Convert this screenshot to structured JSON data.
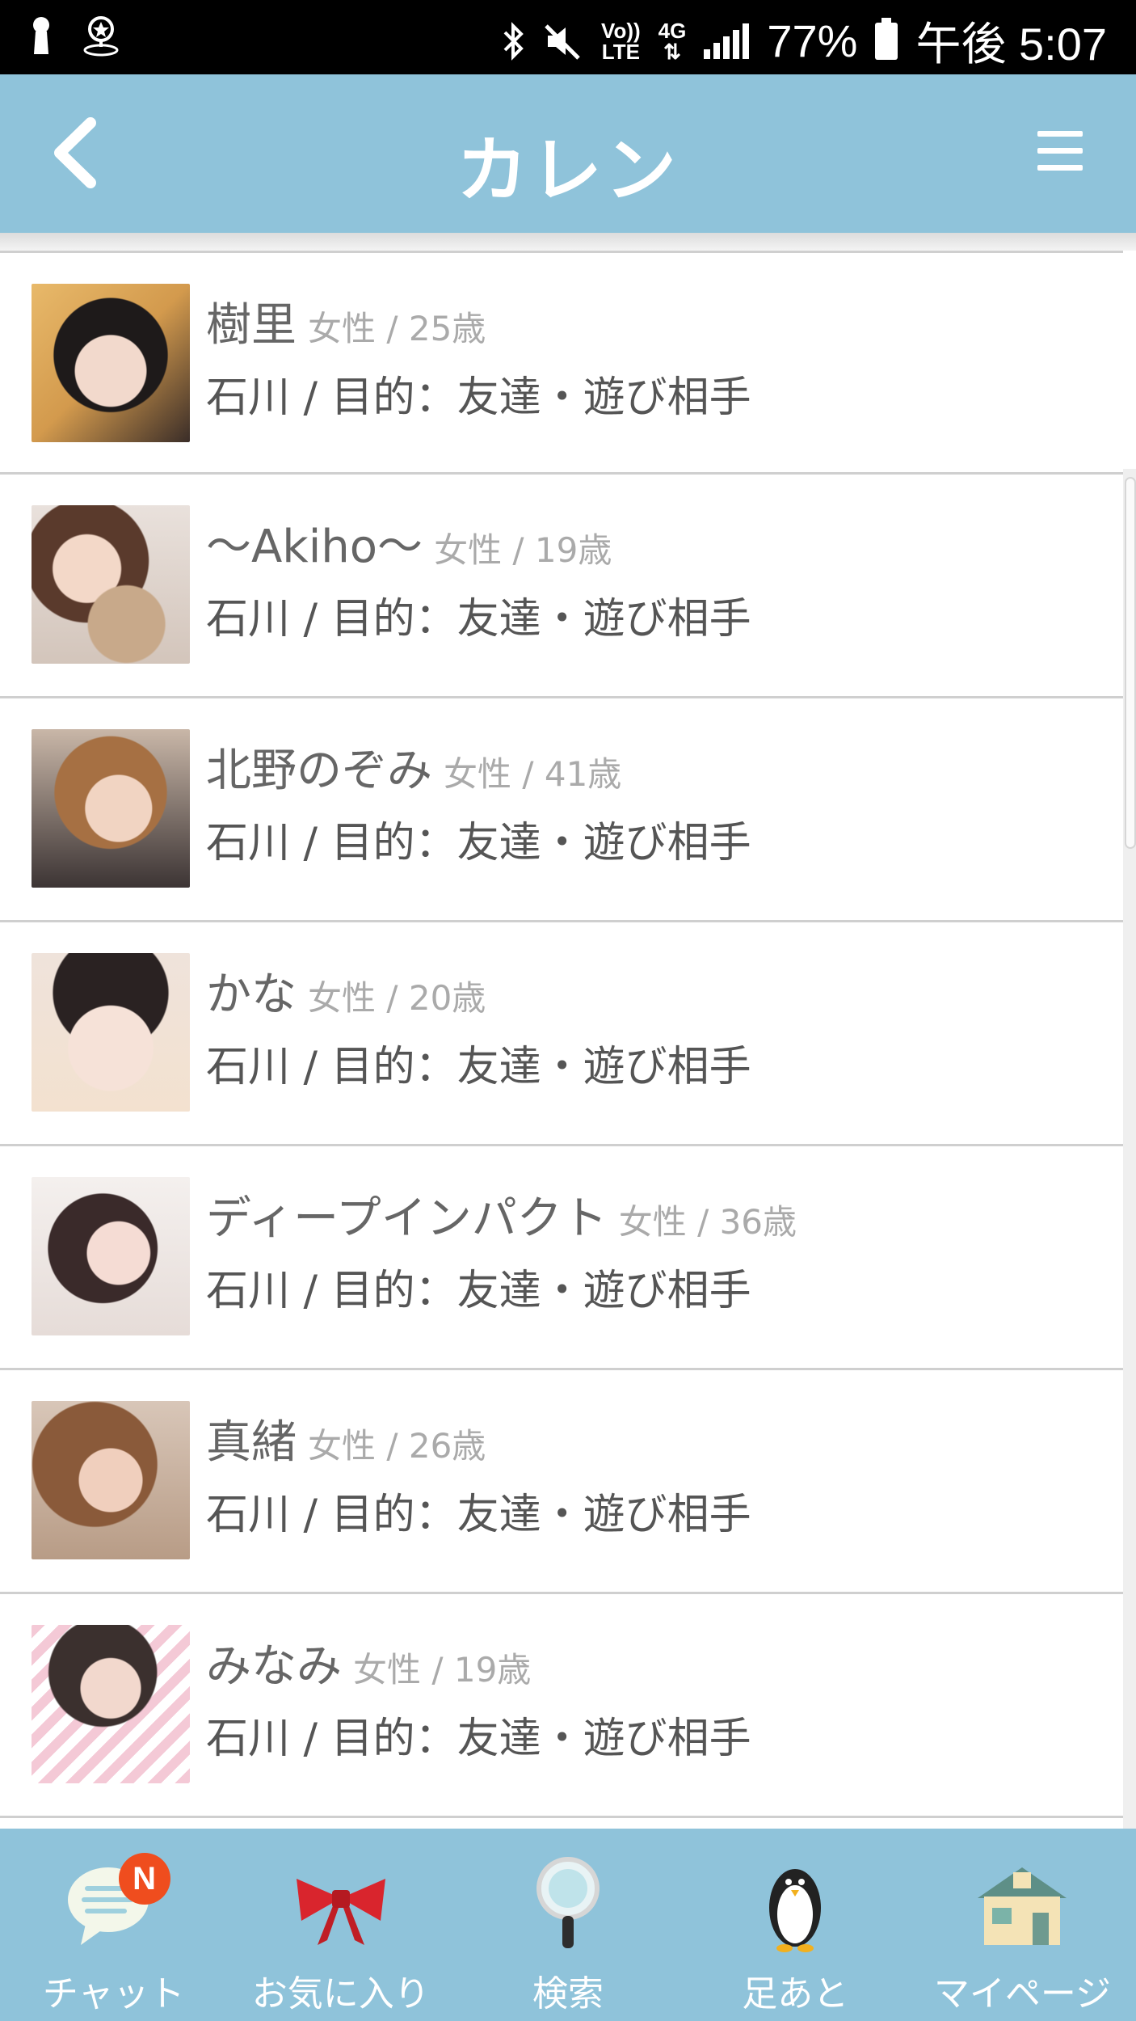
{
  "status_bar": {
    "battery": "77%",
    "time": "午後 5:07",
    "volte_label_top": "Vo))",
    "volte_label_bottom": "LTE",
    "network": "4G",
    "icons": [
      "lock-icon",
      "location-icon",
      "bluetooth-icon",
      "mute-icon",
      "signal-icon",
      "battery-icon"
    ]
  },
  "header": {
    "title": "カレン",
    "back_icon": "chevron-left-icon",
    "menu_icon": "hamburger-menu-icon",
    "background_color": "#8fc3da"
  },
  "users": [
    {
      "name": "樹里",
      "meta": "女性 / 25歳",
      "detail": "石川 / 目的：友達・遊び相手"
    },
    {
      "name": "〜Akiho〜",
      "meta": "女性 / 19歳",
      "detail": "石川 / 目的：友達・遊び相手"
    },
    {
      "name": "北野のぞみ",
      "meta": "女性 / 41歳",
      "detail": "石川 / 目的：友達・遊び相手"
    },
    {
      "name": "かな",
      "meta": "女性 / 20歳",
      "detail": "石川 / 目的：友達・遊び相手"
    },
    {
      "name": "ディープインパクト",
      "meta": "女性 / 36歳",
      "detail": "石川 / 目的：友達・遊び相手"
    },
    {
      "name": "真緒",
      "meta": "女性 / 26歳",
      "detail": "石川 / 目的：友達・遊び相手"
    },
    {
      "name": "みなみ",
      "meta": "女性 / 19歳",
      "detail": "石川 / 目的：友達・遊び相手"
    }
  ],
  "bottom_nav": [
    {
      "label": "チャット",
      "icon": "chat-bubble-icon",
      "badge": "N"
    },
    {
      "label": "お気に入り",
      "icon": "ribbon-bow-icon"
    },
    {
      "label": "検索",
      "icon": "magnifier-icon"
    },
    {
      "label": "足あと",
      "icon": "penguin-icon"
    },
    {
      "label": "マイページ",
      "icon": "house-icon"
    }
  ]
}
